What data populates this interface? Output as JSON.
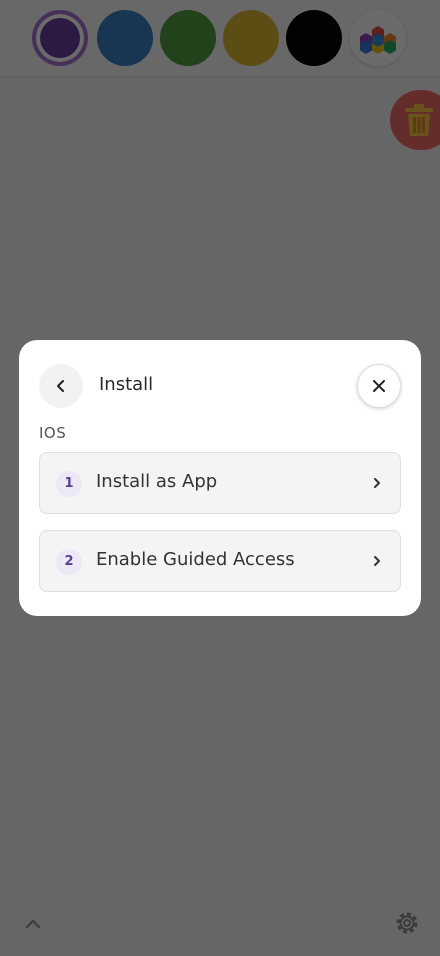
{
  "colors": {
    "swatches": [
      "#6a3fa0",
      "#3b7fc4",
      "#4f9e3e",
      "#dcb733",
      "#050505"
    ],
    "selected_swatch_ring": "#a673d6",
    "trash_button": "#f06a6a",
    "overlay": "rgba(0,0,0,0.58)"
  },
  "toolbar": {
    "icons": [
      "color-swatch-purple",
      "color-swatch-blue",
      "color-swatch-green",
      "color-swatch-yellow",
      "color-swatch-black",
      "palette-icon"
    ],
    "trash_icon": "trash-icon",
    "bottom_left_icon": "chevron-up-icon",
    "bottom_right_icon": "gear-icon"
  },
  "modal": {
    "title": "Install",
    "back_icon": "chevron-left-icon",
    "close_icon": "close-icon",
    "section_label": "iOS",
    "steps": [
      {
        "number": "1",
        "label": "Install as App"
      },
      {
        "number": "2",
        "label": "Enable Guided Access"
      }
    ]
  }
}
